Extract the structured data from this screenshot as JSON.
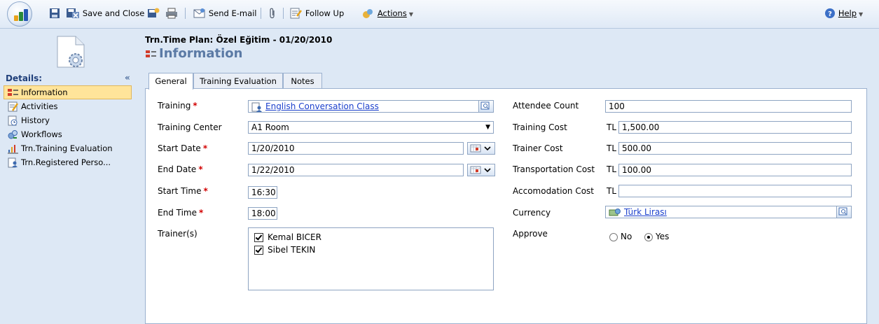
{
  "toolbar": {
    "save_and_close": "Save and Close",
    "send_email": "Send E-mail",
    "follow_up": "Follow Up",
    "actions": "Actions",
    "help": "Help"
  },
  "sidebar": {
    "header": "Details:",
    "items": [
      {
        "label": "Information",
        "icon": "form-icon",
        "selected": true
      },
      {
        "label": "Activities",
        "icon": "activities-icon"
      },
      {
        "label": "History",
        "icon": "history-icon"
      },
      {
        "label": "Workflows",
        "icon": "workflows-icon"
      },
      {
        "label": "Trn.Training Evaluation",
        "icon": "chart-icon"
      },
      {
        "label": "Trn.Registered Perso...",
        "icon": "person-doc-icon"
      }
    ]
  },
  "header": {
    "record_title": "Trn.Time Plan: Özel Eğitim - 01/20/2010",
    "section_title": "Information"
  },
  "tabs": [
    {
      "label": "General",
      "active": true
    },
    {
      "label": "Training Evaluation"
    },
    {
      "label": "Notes"
    }
  ],
  "form": {
    "training": {
      "label": "Training",
      "value": "English Conversation Class"
    },
    "training_center": {
      "label": "Training Center",
      "value": "A1 Room"
    },
    "start_date": {
      "label": "Start Date",
      "value": "1/20/2010"
    },
    "end_date": {
      "label": "End Date",
      "value": "1/22/2010"
    },
    "start_time": {
      "label": "Start Time",
      "value": "16:30"
    },
    "end_time": {
      "label": "End Time",
      "value": "18:00"
    },
    "trainers": {
      "label": "Trainer(s)",
      "items": [
        {
          "name": "Kemal BICER",
          "checked": true
        },
        {
          "name": "Sibel TEKIN",
          "checked": true
        }
      ]
    },
    "attendee_count": {
      "label": "Attendee Count",
      "value": "100"
    },
    "training_cost": {
      "label": "Training Cost",
      "currency": "TL",
      "value": "1,500.00"
    },
    "trainer_cost": {
      "label": "Trainer Cost",
      "currency": "TL",
      "value": "500.00"
    },
    "transportation_cost": {
      "label": "Transportation Cost",
      "currency": "TL",
      "value": "100.00"
    },
    "accomodation_cost": {
      "label": "Accomodation Cost",
      "currency": "TL",
      "value": ""
    },
    "currency": {
      "label": "Currency",
      "value": "Türk Lirası"
    },
    "approve": {
      "label": "Approve",
      "option_no": "No",
      "option_yes": "Yes",
      "selected": "Yes"
    }
  },
  "colors": {
    "accent": "#5b7aa5",
    "link": "#1a3fcc",
    "required": "#d20000",
    "selected_nav": "#ffe49a"
  }
}
